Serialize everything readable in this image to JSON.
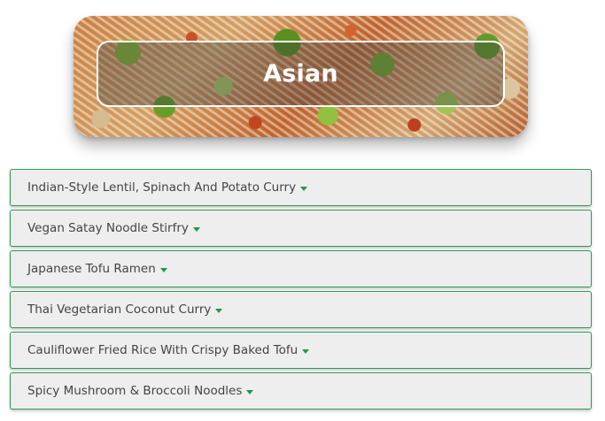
{
  "hero": {
    "title": "Asian"
  },
  "recipes": [
    {
      "label": "Indian-Style Lentil, Spinach And Potato Curry",
      "icon": "chevron-down-icon"
    },
    {
      "label": "Vegan Satay Noodle Stirfry",
      "icon": "chevron-down-icon"
    },
    {
      "label": "Japanese Tofu Ramen",
      "icon": "chevron-down-icon"
    },
    {
      "label": "Thai Vegetarian Coconut Curry",
      "icon": "chevron-down-icon"
    },
    {
      "label": "Cauliflower Fried Rice With Crispy Baked Tofu",
      "icon": "chevron-down-icon"
    },
    {
      "label": "Spicy Mushroom & Broccoli Noodles",
      "icon": "chevron-down-icon"
    }
  ],
  "colors": {
    "accent": "#1f9a4a",
    "border": "#2e9a55",
    "item_background": "#eeeeee",
    "text": "#444444"
  }
}
